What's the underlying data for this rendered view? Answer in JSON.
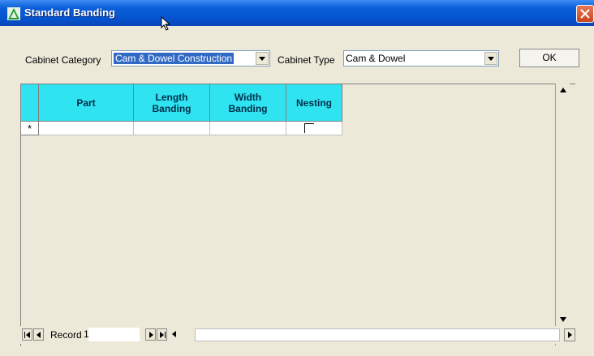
{
  "window": {
    "title": "Standard Banding"
  },
  "toolbar": {
    "cabinet_category_label": "Cabinet Category",
    "cabinet_category_value": "Cam & Dowel Construction",
    "cabinet_type_label": "Cabinet Type",
    "cabinet_type_value": "Cam & Dowel",
    "ok_label": "OK"
  },
  "grid": {
    "columns": [
      "Part",
      "Length Banding",
      "Width Banding",
      "Nesting"
    ],
    "new_row_marker": "*"
  },
  "navigator": {
    "record_label": "Record",
    "record_number": "1"
  },
  "colors": {
    "header_background": "#2fe3f0",
    "selection": "#316ac5",
    "titlebar": "#0554d0"
  },
  "icons": {
    "app": "triangle-app-icon",
    "cursor": "mouse-pointer-icon",
    "close": "close-icon"
  }
}
